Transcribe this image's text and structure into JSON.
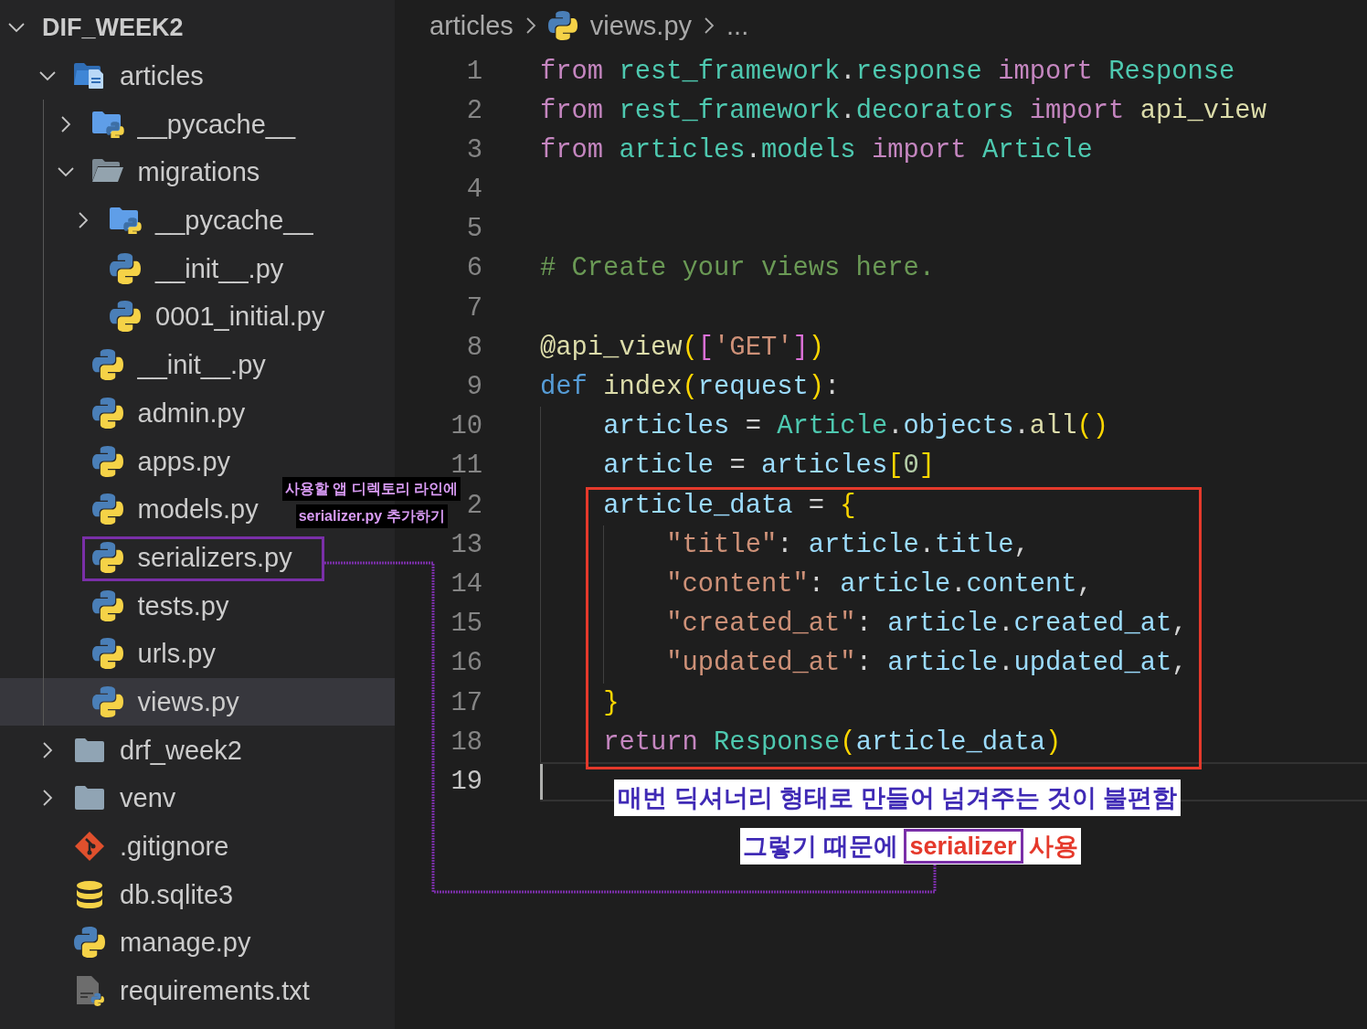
{
  "explorer": {
    "root": {
      "label": "DIF_WEEK2",
      "expanded": true
    },
    "items": [
      {
        "label": "articles",
        "kind": "app-folder",
        "expanded": true,
        "selected": false,
        "children": [
          {
            "label": "__pycache__",
            "kind": "python-folder",
            "expanded": false,
            "selected": false
          },
          {
            "label": "migrations",
            "kind": "open-folder",
            "expanded": true,
            "selected": false,
            "children": [
              {
                "label": "__pycache__",
                "kind": "python-folder",
                "expanded": false,
                "selected": false
              },
              {
                "label": "__init__.py",
                "kind": "python",
                "selected": false
              },
              {
                "label": "0001_initial.py",
                "kind": "python",
                "selected": false
              }
            ]
          },
          {
            "label": "__init__.py",
            "kind": "python",
            "selected": false
          },
          {
            "label": "admin.py",
            "kind": "python",
            "selected": false
          },
          {
            "label": "apps.py",
            "kind": "python",
            "selected": false
          },
          {
            "label": "models.py",
            "kind": "python",
            "selected": false
          },
          {
            "label": "serializers.py",
            "kind": "python",
            "selected": false
          },
          {
            "label": "tests.py",
            "kind": "python",
            "selected": false
          },
          {
            "label": "urls.py",
            "kind": "python",
            "selected": false
          },
          {
            "label": "views.py",
            "kind": "python",
            "selected": true
          }
        ]
      },
      {
        "label": "drf_week2",
        "kind": "folder",
        "expanded": false,
        "selected": false
      },
      {
        "label": "venv",
        "kind": "folder",
        "expanded": false,
        "selected": false
      },
      {
        "label": ".gitignore",
        "kind": "git",
        "selected": false
      },
      {
        "label": "db.sqlite3",
        "kind": "database",
        "selected": false
      },
      {
        "label": "manage.py",
        "kind": "python",
        "selected": false
      },
      {
        "label": "requirements.txt",
        "kind": "requirements",
        "selected": false
      }
    ]
  },
  "editor": {
    "breadcrumb": [
      {
        "label": "articles",
        "kind": "folder"
      },
      {
        "label": "views.py",
        "kind": "python"
      },
      {
        "label": "...",
        "kind": "more"
      }
    ],
    "lines": [
      {
        "number": "1",
        "current": false,
        "tokens": [
          {
            "text": "from",
            "kind": "keyword"
          },
          {
            "text": " rest_framework",
            "kind": "module"
          },
          {
            "text": ".",
            "kind": "plain"
          },
          {
            "text": "response",
            "kind": "module"
          },
          {
            "text": " import",
            "kind": "keyword"
          },
          {
            "text": " Response",
            "kind": "module"
          }
        ]
      },
      {
        "number": "2",
        "current": false,
        "tokens": [
          {
            "text": "from",
            "kind": "keyword"
          },
          {
            "text": " rest_framework",
            "kind": "module"
          },
          {
            "text": ".",
            "kind": "plain"
          },
          {
            "text": "decorators",
            "kind": "module"
          },
          {
            "text": " import",
            "kind": "keyword"
          },
          {
            "text": " api_view",
            "kind": "function"
          }
        ]
      },
      {
        "number": "3",
        "current": false,
        "tokens": [
          {
            "text": "from",
            "kind": "keyword"
          },
          {
            "text": " articles",
            "kind": "module"
          },
          {
            "text": ".",
            "kind": "plain"
          },
          {
            "text": "models",
            "kind": "module"
          },
          {
            "text": " import",
            "kind": "keyword"
          },
          {
            "text": " Article",
            "kind": "module"
          }
        ]
      },
      {
        "number": "4",
        "current": false
      },
      {
        "number": "5",
        "current": false
      },
      {
        "number": "6",
        "current": false,
        "tokens": [
          {
            "text": "# Create your views here.",
            "kind": "comment"
          }
        ]
      },
      {
        "number": "7",
        "current": false
      },
      {
        "number": "8",
        "current": false,
        "tokens": [
          {
            "text": "@api_view",
            "kind": "function"
          },
          {
            "text": "(",
            "kind": "bracket"
          },
          {
            "text": "[",
            "kind": "bracket2"
          },
          {
            "text": "'GET'",
            "kind": "string"
          },
          {
            "text": "]",
            "kind": "bracket2"
          },
          {
            "text": ")",
            "kind": "bracket"
          }
        ]
      },
      {
        "number": "9",
        "current": false,
        "tokens": [
          {
            "text": "def",
            "kind": "storage"
          },
          {
            "text": " index",
            "kind": "function"
          },
          {
            "text": "(",
            "kind": "bracket"
          },
          {
            "text": "request",
            "kind": "variable"
          },
          {
            "text": ")",
            "kind": "bracket"
          },
          {
            "text": ":",
            "kind": "plain"
          }
        ]
      },
      {
        "number": "10",
        "current": false,
        "tokens": [
          {
            "text": "    articles",
            "kind": "variable"
          },
          {
            "text": " = ",
            "kind": "plain"
          },
          {
            "text": "Article",
            "kind": "module"
          },
          {
            "text": ".",
            "kind": "plain"
          },
          {
            "text": "objects",
            "kind": "variable"
          },
          {
            "text": ".",
            "kind": "plain"
          },
          {
            "text": "all",
            "kind": "function"
          },
          {
            "text": "()",
            "kind": "bracket"
          }
        ]
      },
      {
        "number": "11",
        "current": false,
        "tokens": [
          {
            "text": "    article",
            "kind": "variable"
          },
          {
            "text": " = ",
            "kind": "plain"
          },
          {
            "text": "articles",
            "kind": "variable"
          },
          {
            "text": "[",
            "kind": "bracket"
          },
          {
            "text": "0",
            "kind": "number"
          },
          {
            "text": "]",
            "kind": "bracket"
          }
        ]
      },
      {
        "number": "2",
        "current": false,
        "tokens": [
          {
            "text": "    article_data",
            "kind": "variable"
          },
          {
            "text": " = ",
            "kind": "plain"
          },
          {
            "text": "{",
            "kind": "bracket"
          }
        ]
      },
      {
        "number": "13",
        "current": false,
        "tokens": [
          {
            "text": "        \"title\"",
            "kind": "string"
          },
          {
            "text": ": ",
            "kind": "plain"
          },
          {
            "text": "article",
            "kind": "variable"
          },
          {
            "text": ".",
            "kind": "plain"
          },
          {
            "text": "title",
            "kind": "variable"
          },
          {
            "text": ",",
            "kind": "plain"
          }
        ]
      },
      {
        "number": "14",
        "current": false,
        "tokens": [
          {
            "text": "        \"content\"",
            "kind": "string"
          },
          {
            "text": ": ",
            "kind": "plain"
          },
          {
            "text": "article",
            "kind": "variable"
          },
          {
            "text": ".",
            "kind": "plain"
          },
          {
            "text": "content",
            "kind": "variable"
          },
          {
            "text": ",",
            "kind": "plain"
          }
        ]
      },
      {
        "number": "15",
        "current": false,
        "tokens": [
          {
            "text": "        \"created_at\"",
            "kind": "string"
          },
          {
            "text": ": ",
            "kind": "plain"
          },
          {
            "text": "article",
            "kind": "variable"
          },
          {
            "text": ".",
            "kind": "plain"
          },
          {
            "text": "created_at",
            "kind": "variable"
          },
          {
            "text": ",",
            "kind": "plain"
          }
        ]
      },
      {
        "number": "16",
        "current": false,
        "tokens": [
          {
            "text": "        \"updated_at\"",
            "kind": "string"
          },
          {
            "text": ": ",
            "kind": "plain"
          },
          {
            "text": "article",
            "kind": "variable"
          },
          {
            "text": ".",
            "kind": "plain"
          },
          {
            "text": "updated_at",
            "kind": "variable"
          },
          {
            "text": ",",
            "kind": "plain"
          }
        ]
      },
      {
        "number": "17",
        "current": false,
        "tokens": [
          {
            "text": "    }",
            "kind": "bracket"
          }
        ]
      },
      {
        "number": "18",
        "current": false,
        "tokens": [
          {
            "text": "    return",
            "kind": "keyword"
          },
          {
            "text": " Response",
            "kind": "module"
          },
          {
            "text": "(",
            "kind": "bracket"
          },
          {
            "text": "article_data",
            "kind": "variable"
          },
          {
            "text": ")",
            "kind": "bracket"
          }
        ]
      },
      {
        "number": "19",
        "current": true
      }
    ]
  },
  "callouts": {
    "serializer_note": [
      "사용할 앱 디렉토리 라인에",
      "serializer.py 추가하기"
    ],
    "problem_note": "매번 딕셔너리 형태로 만들어 넘겨주는 것이 불편함",
    "solution_note": [
      {
        "text": "그렇기 때문에",
        "kind": "plain"
      },
      {
        "text": "serializer",
        "kind": "boxed"
      },
      {
        "text": "사용",
        "kind": "accent"
      }
    ]
  }
}
